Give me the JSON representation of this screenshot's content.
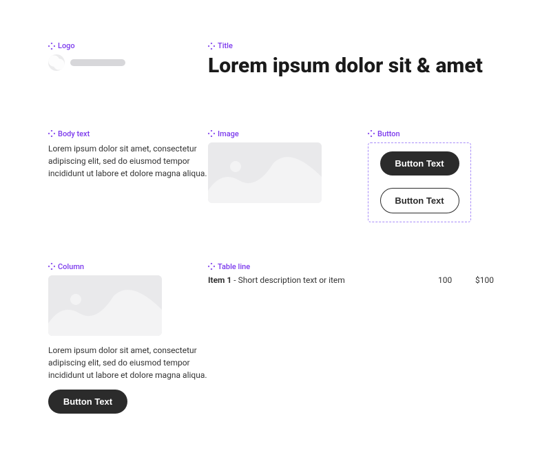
{
  "labels": {
    "logo": "Logo",
    "title": "Title",
    "body": "Body text",
    "image": "Image",
    "button": "Button",
    "column": "Column",
    "table": "Table line"
  },
  "title": "Lorem ipsum dolor sit & amet",
  "body_text": "Lorem ipsum dolor sit amet, consectetur adipiscing elit, sed do eiusmod tempor incididunt ut labore et dolore magna aliqua.",
  "buttons": {
    "primary": "Button Text",
    "secondary": "Button Text"
  },
  "column": {
    "text": "Lorem ipsum dolor sit amet, consectetur adipiscing elit, sed do eiusmod tempor incididunt ut labore et dolore magna aliqua.",
    "button": "Button Text"
  },
  "table": {
    "item_label": "Item 1",
    "separator": " - ",
    "description": "Short description text or item",
    "qty": "100",
    "price": "$100"
  }
}
